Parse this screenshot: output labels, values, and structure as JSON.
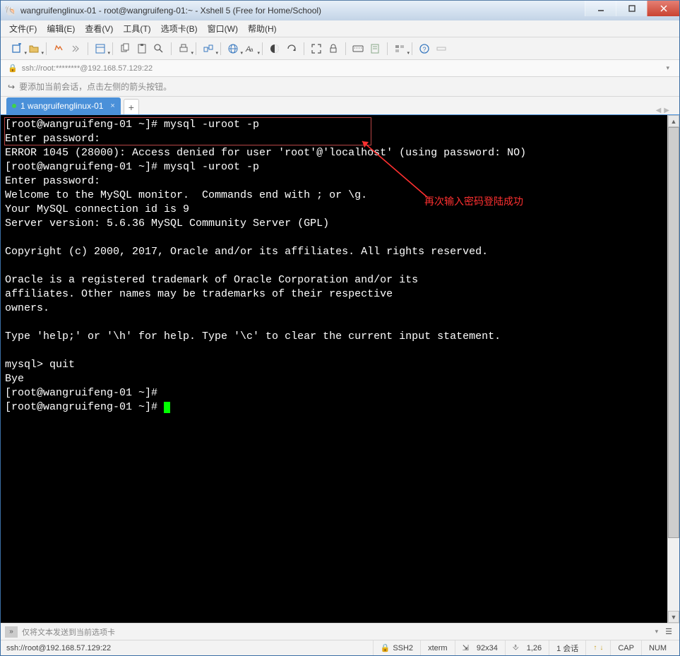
{
  "window": {
    "title": "wangruifenglinux-01 - root@wangruifeng-01:~ - Xshell 5 (Free for Home/School)"
  },
  "menu": {
    "file": "文件(F)",
    "edit": "编辑(E)",
    "view": "查看(V)",
    "tools": "工具(T)",
    "tabs": "选项卡(B)",
    "window": "窗口(W)",
    "help": "帮助(H)"
  },
  "addressbar": {
    "text": "ssh://root:********@192.168.57.129:22"
  },
  "hintbar": {
    "text": "要添加当前会话，点击左侧的箭头按钮。"
  },
  "tab": {
    "label": "1 wangruifenglinux-01",
    "close": "×",
    "add": "+"
  },
  "terminal": {
    "lines": [
      "[root@wangruifeng-01 ~]# mysql -uroot -p",
      "Enter password: ",
      "ERROR 1045 (28000): Access denied for user 'root'@'localhost' (using password: NO)",
      "[root@wangruifeng-01 ~]# mysql -uroot -p",
      "Enter password: ",
      "Welcome to the MySQL monitor.  Commands end with ; or \\g.",
      "Your MySQL connection id is 9",
      "Server version: 5.6.36 MySQL Community Server (GPL)",
      "",
      "Copyright (c) 2000, 2017, Oracle and/or its affiliates. All rights reserved.",
      "",
      "Oracle is a registered trademark of Oracle Corporation and/or its",
      "affiliates. Other names may be trademarks of their respective",
      "owners.",
      "",
      "Type 'help;' or '\\h' for help. Type '\\c' to clear the current input statement.",
      "",
      "mysql> quit",
      "Bye",
      "[root@wangruifeng-01 ~]# ",
      "[root@wangruifeng-01 ~]# "
    ],
    "annotation": "再次输入密码登陆成功"
  },
  "sendbar": {
    "text": "仅将文本发送到当前选项卡"
  },
  "status": {
    "conn": "ssh://root@192.168.57.129:22",
    "ssh": "SSH2",
    "termtype": "xterm",
    "size": "92x34",
    "pos": "1,26",
    "session": "1 会话",
    "caps": "CAP",
    "num": "NUM"
  }
}
